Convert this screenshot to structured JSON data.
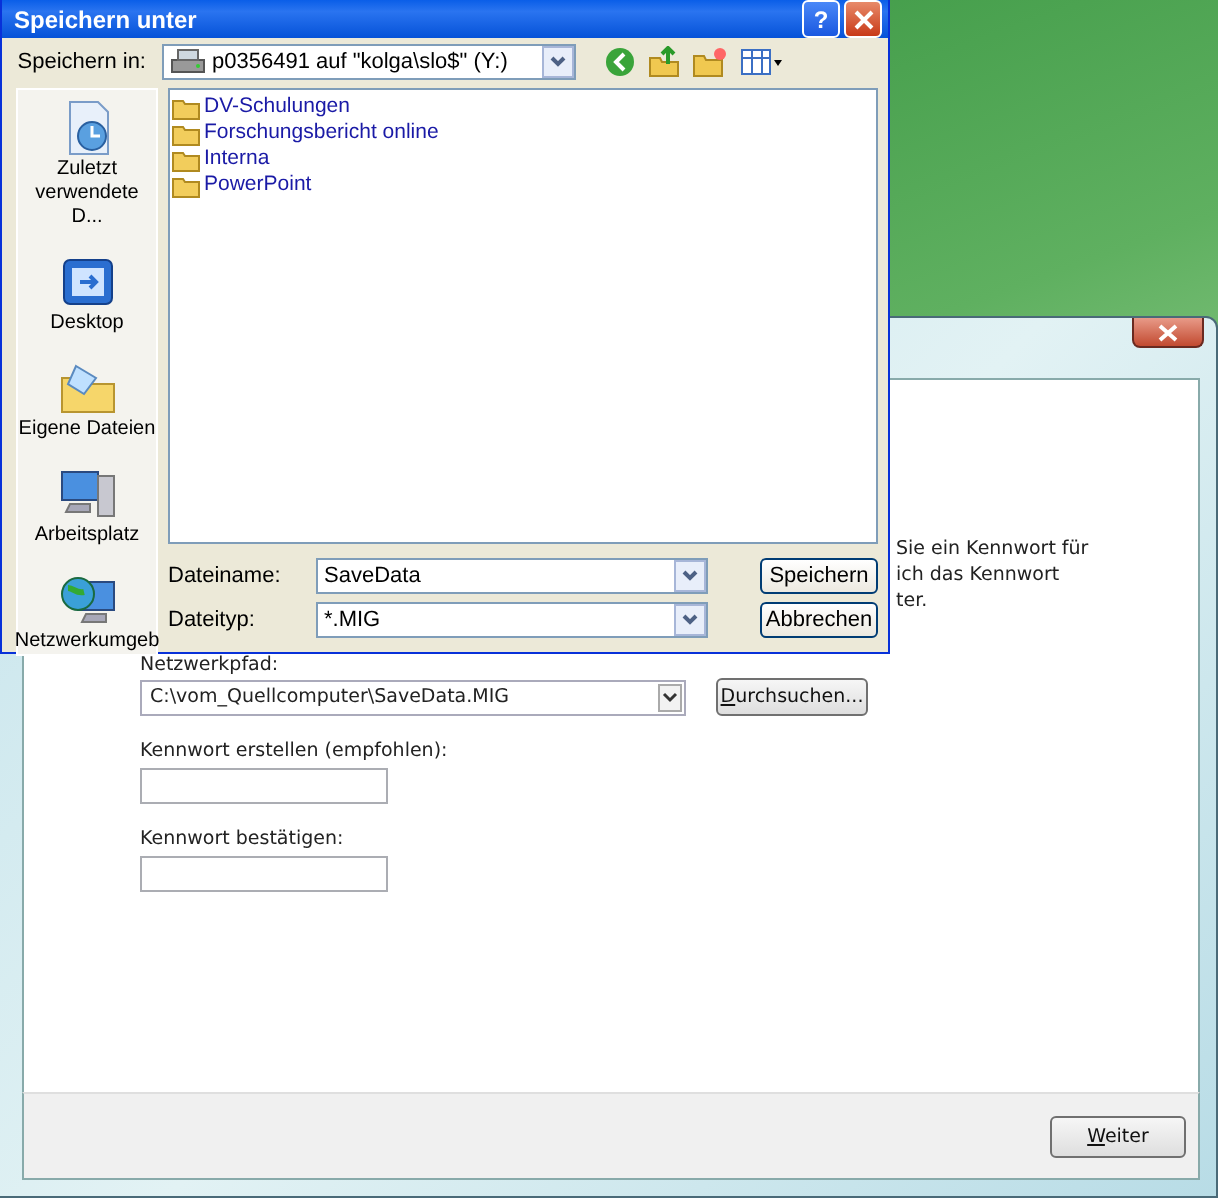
{
  "back_window": {
    "intro_lines": [
      "Sie ein Kennwort für",
      "ich das Kennwort",
      "ter."
    ],
    "path_label": "Netzwerkpfad:",
    "path_value": "C:\\vom_Quellcomputer\\SaveData.MIG",
    "browse_button": "Durchsuchen...",
    "password_label": "Kennwort erstellen (empfohlen):",
    "confirm_label": "Kennwort bestätigen:",
    "next_button": "Weiter"
  },
  "save_dialog": {
    "title": "Speichern unter",
    "help_button": "?",
    "save_in_label": "Speichern in:",
    "save_in_value": "p0356491 auf \"kolga\\slo$\" (Y:)",
    "places": [
      {
        "kind": "recent",
        "label": "Zuletzt verwendete D..."
      },
      {
        "kind": "desktop",
        "label": "Desktop"
      },
      {
        "kind": "documents",
        "label": "Eigene Dateien"
      },
      {
        "kind": "computer",
        "label": "Arbeitsplatz"
      },
      {
        "kind": "network",
        "label": "Netzwerkumgeb"
      }
    ],
    "files": [
      {
        "name": "DV-Schulungen"
      },
      {
        "name": "Forschungsbericht online"
      },
      {
        "name": "Interna"
      },
      {
        "name": "PowerPoint"
      }
    ],
    "filename_label": "Dateiname:",
    "filename_value": "SaveData",
    "filetype_label": "Dateityp:",
    "filetype_value": "*.MIG",
    "save_button": "Speichern",
    "cancel_button": "Abbrechen"
  }
}
